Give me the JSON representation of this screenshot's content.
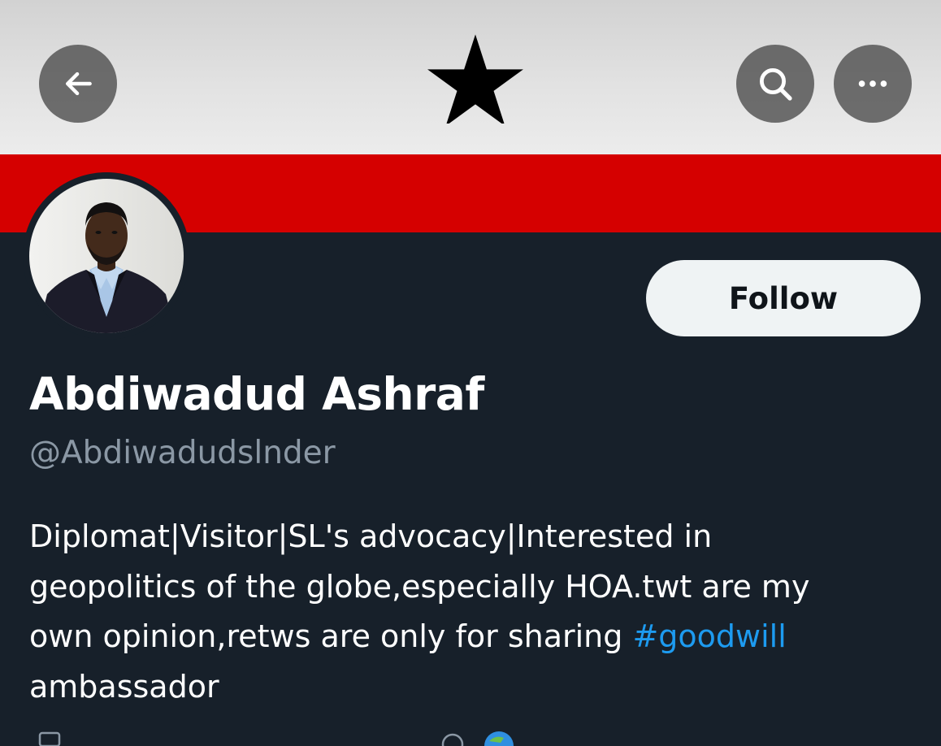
{
  "header": {
    "back_icon": "arrow-left-icon",
    "search_icon": "search-icon",
    "more_icon": "more-horizontal-icon"
  },
  "banner": {
    "description_colors": {
      "top": "#e6e6e6",
      "bottom": "#d50000",
      "star": "#000000"
    }
  },
  "profile": {
    "display_name": "Abdiwadud Ashraf",
    "handle": "@Abdiwadudslnder",
    "follow_label": "Follow",
    "bio_lines": [
      "Diplomat|Visitor|SL's advocacy|Interested in",
      "geopolitics of the globe,especially HOA.twt are my",
      "own opinion,retws are only for sharing ",
      "ambassador"
    ],
    "bio_hashtag": "#goodwill"
  },
  "colors": {
    "background": "#17202a",
    "accent": "#1d9bf0",
    "follow_bg": "#eff3f4",
    "secondary_text": "#8b98a5"
  }
}
